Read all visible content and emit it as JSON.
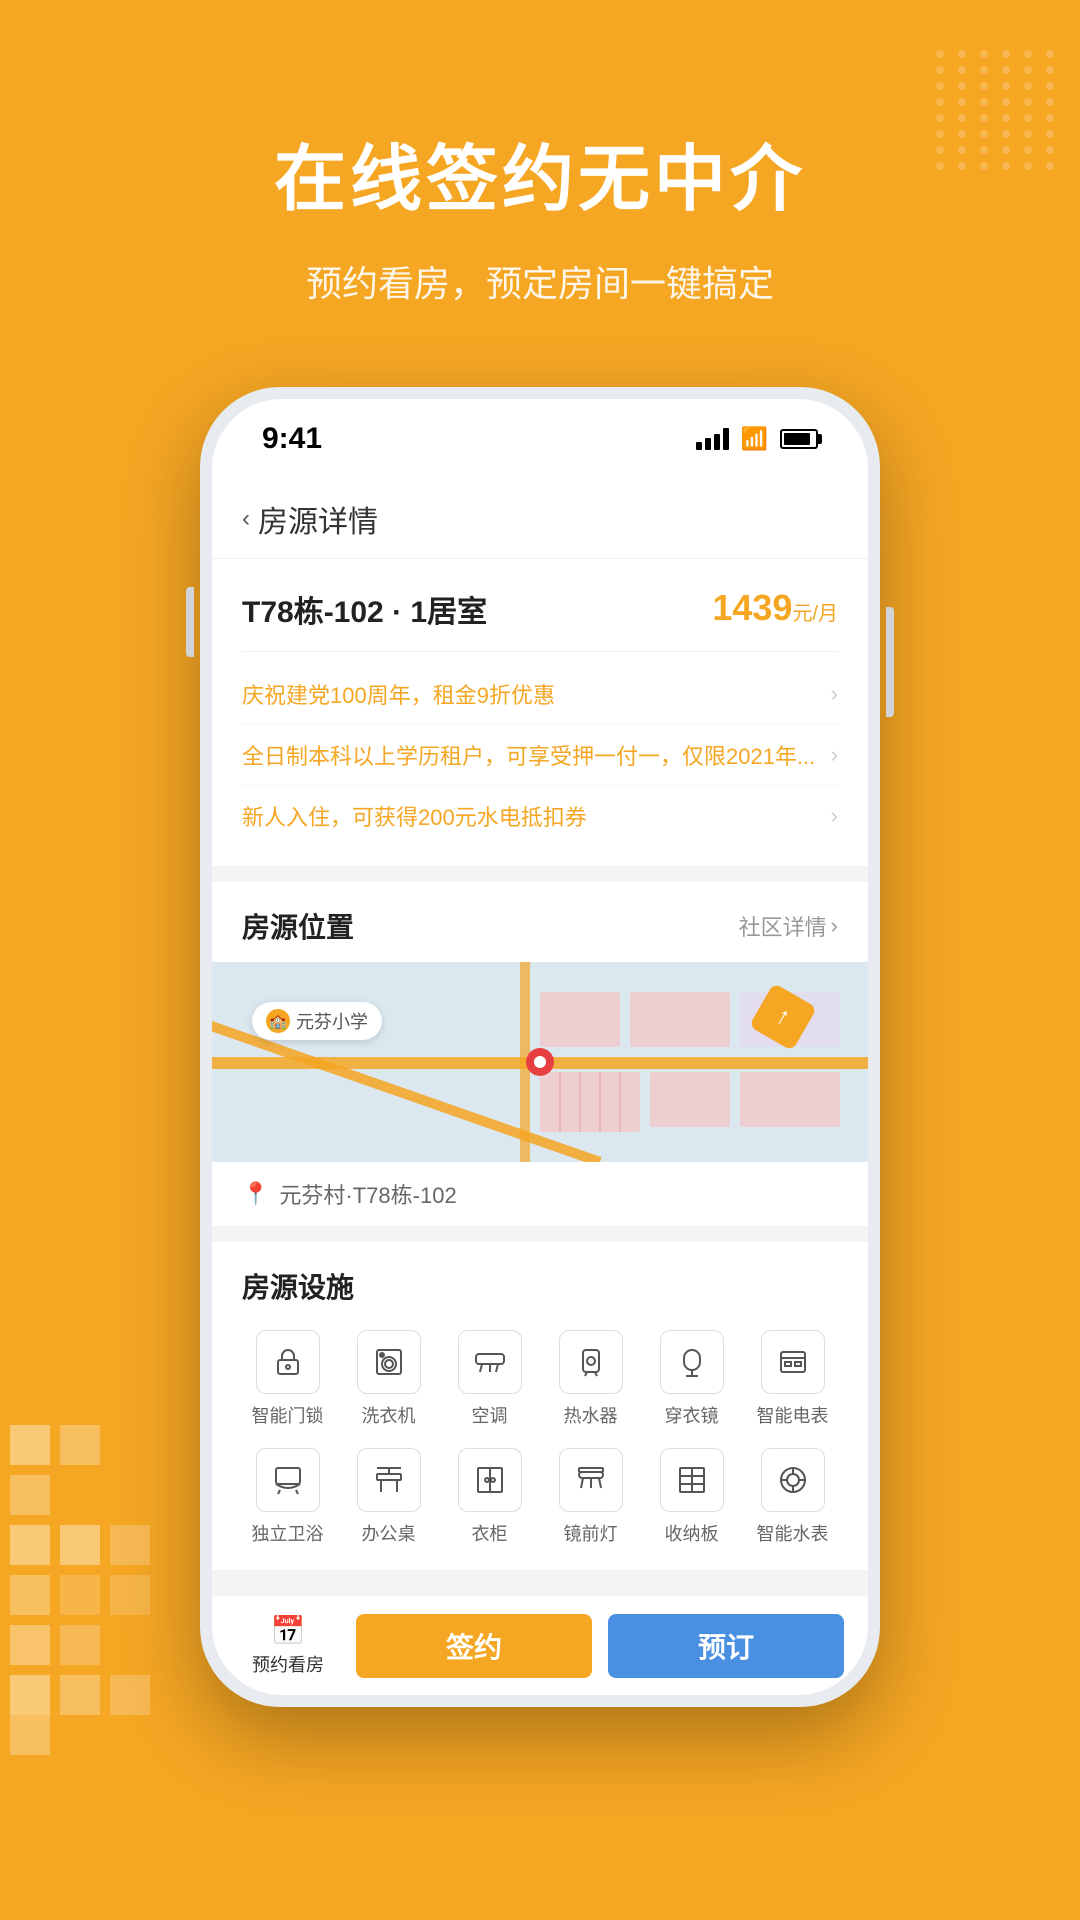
{
  "header": {
    "main_title": "在线签约无中介",
    "sub_title": "预约看房，预定房间一键搞定"
  },
  "phone": {
    "status_bar": {
      "time": "9:41"
    },
    "nav": {
      "back_label": "房源详情"
    },
    "room": {
      "title": "T78栋-102 · 1居室",
      "price": "1439",
      "price_unit": "元/月",
      "promotions": [
        {
          "text": "庆祝建党100周年，租金9折优惠"
        },
        {
          "text": "全日制本科以上学历租户，可享受押一付一，仅限2021年..."
        },
        {
          "text": "新人入住，可获得200元水电抵扣券"
        }
      ]
    },
    "location": {
      "section_title": "房源位置",
      "community_link": "社区详情",
      "address_label": "元芬村·T78栋-102",
      "map_label": "元芬小学"
    },
    "facilities": {
      "section_title": "房源设施",
      "items": [
        {
          "label": "智能门锁",
          "icon": "🔒"
        },
        {
          "label": "洗衣机",
          "icon": "🫧"
        },
        {
          "label": "空调",
          "icon": "❄️"
        },
        {
          "label": "热水器",
          "icon": "🚿"
        },
        {
          "label": "穿衣镜",
          "icon": "🪞"
        },
        {
          "label": "智能电表",
          "icon": "⚡"
        },
        {
          "label": "独立卫浴",
          "icon": "🚿"
        },
        {
          "label": "办公桌",
          "icon": "🪑"
        },
        {
          "label": "衣柜",
          "icon": "🗄️"
        },
        {
          "label": "镜前灯",
          "icon": "💡"
        },
        {
          "label": "收纳板",
          "icon": "📦"
        },
        {
          "label": "智能水表",
          "icon": "💧"
        }
      ]
    },
    "bottom_bar": {
      "nav_label": "预约看房",
      "sign_btn": "签约",
      "reserve_btn": "预订"
    }
  }
}
